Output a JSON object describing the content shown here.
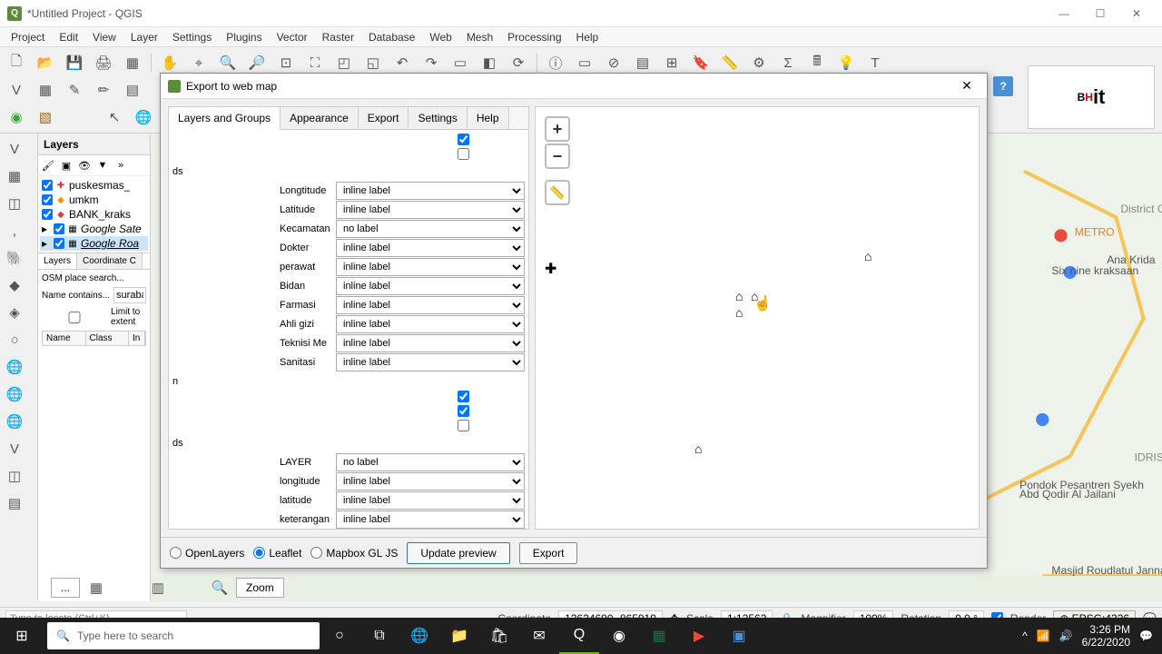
{
  "window": {
    "title": "*Untitled Project - QGIS"
  },
  "menu": [
    "Project",
    "Edit",
    "View",
    "Layer",
    "Settings",
    "Plugins",
    "Vector",
    "Raster",
    "Database",
    "Web",
    "Mesh",
    "Processing",
    "Help"
  ],
  "layers_panel": {
    "title": "Layers",
    "items": [
      {
        "checked": true,
        "symbol": "✚",
        "color": "#d33",
        "name": "puskesmas_"
      },
      {
        "checked": true,
        "symbol": "⬥",
        "color": "#e90",
        "name": "umkm"
      },
      {
        "checked": true,
        "symbol": "⬥",
        "color": "#c43",
        "name": "BANK_kraks"
      },
      {
        "checked": true,
        "symbol": "▦",
        "color": "#888",
        "name": "Google Sate",
        "italic": true
      },
      {
        "checked": true,
        "symbol": "▦",
        "color": "#888",
        "name": "Google Roa",
        "italic": true,
        "selected": true,
        "underline": true
      }
    ],
    "tabs": [
      "Layers",
      "Coordinate C"
    ],
    "osm_title": "OSM place search...",
    "name_contains_label": "Name contains...",
    "name_contains_value": "suraba",
    "limit_label": "Limit to extent",
    "columns": [
      "Name",
      "Class",
      "In"
    ]
  },
  "dialog": {
    "title": "Export to web map",
    "tabs": [
      "Layers and Groups",
      "Appearance",
      "Export",
      "Settings",
      "Help"
    ],
    "active_tab": 0,
    "group1_label": "ds",
    "group2": "n",
    "group2_ds": "ds",
    "fields1": [
      {
        "label": "Longtitude",
        "value": "inline label"
      },
      {
        "label": "Latitude",
        "value": "inline label"
      },
      {
        "label": "Kecamatan",
        "value": "no label"
      },
      {
        "label": "Dokter",
        "value": "inline label"
      },
      {
        "label": "perawat",
        "value": "inline label"
      },
      {
        "label": "Bidan",
        "value": "inline label"
      },
      {
        "label": "Farmasi",
        "value": "inline label"
      },
      {
        "label": "Ahli gizi",
        "value": "inline label"
      },
      {
        "label": "Teknisi Me",
        "value": "inline label"
      },
      {
        "label": "Sanitasi",
        "value": "inline label"
      }
    ],
    "fields2": [
      {
        "label": "LAYER",
        "value": "no label"
      },
      {
        "label": "longitude",
        "value": "inline label"
      },
      {
        "label": "latitude",
        "value": "inline label"
      },
      {
        "label": "keterangan",
        "value": "inline label"
      }
    ],
    "format_options": [
      "OpenLayers",
      "Leaflet",
      "Mapbox GL JS"
    ],
    "format_selected": 1,
    "update_preview": "Update preview",
    "export": "Export"
  },
  "bottom_tools": {
    "more": "...",
    "zoom": "Zoom"
  },
  "status": {
    "locate_placeholder": "Type to locate (Ctrl+K)",
    "coord_label": "Coordinate",
    "coord_value": "12624690,-865919",
    "scale_label": "Scale",
    "scale_value": "1:12562",
    "magnifier_label": "Magnifier",
    "magnifier_value": "100%",
    "rotation_label": "Rotation",
    "rotation_value": "0.0 °",
    "render_label": "Render",
    "crs": "EPSG:4326"
  },
  "taskbar": {
    "search_placeholder": "Type here to search",
    "time": "3:26 PM",
    "date": "6/22/2020"
  },
  "logo": {
    "text_b": "B",
    "text_h": "H",
    "text_it": "it"
  }
}
